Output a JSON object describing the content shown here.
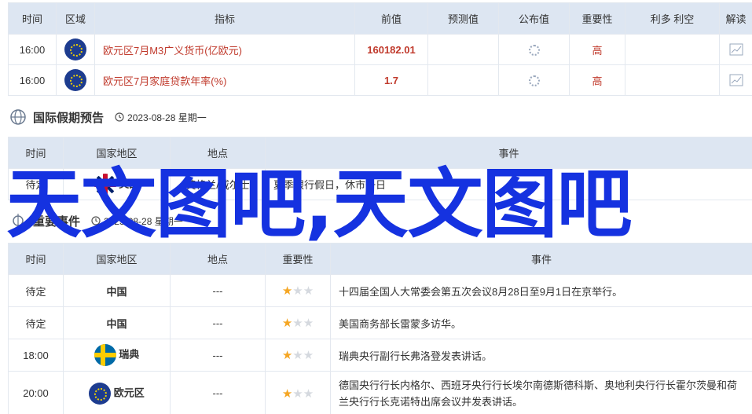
{
  "calendar_table": {
    "headers": [
      "时间",
      "区域",
      "指标",
      "前值",
      "预测值",
      "公布值",
      "重要性",
      "利多 利空",
      "解读"
    ],
    "rows": [
      {
        "time": "16:00",
        "flag": "eu-flag",
        "indicator": "欧元区7月M3广义货币(亿欧元)",
        "previous": "160182.01",
        "forecast": "",
        "actual": "loading-spinner-icon",
        "importance": "高"
      },
      {
        "time": "16:00",
        "flag": "eu-flag",
        "indicator": "欧元区7月家庭贷款年率(%)",
        "previous": "1.7",
        "forecast": "",
        "actual": "loading-spinner-icon",
        "importance": "高"
      }
    ]
  },
  "holiday_section": {
    "title": "国际假期预告",
    "date": "2023-08-28 星期一",
    "headers": [
      "时间",
      "国家地区",
      "地点",
      "事件"
    ],
    "rows": [
      {
        "time": "待定",
        "flag": "uk-flag",
        "country": "英国",
        "location": "英格兰/威尔士",
        "event": "夏季银行假日，休市一日"
      }
    ]
  },
  "events_section": {
    "title": "重要事件",
    "date": "2023-08-28 星期一",
    "headers": [
      "时间",
      "国家地区",
      "地点",
      "重要性",
      "事件"
    ],
    "rows": [
      {
        "time": "待定",
        "country": "中国",
        "location": "---",
        "stars": 1,
        "event": "十四届全国人大常委会第五次会议8月28日至9月1日在京举行。"
      },
      {
        "time": "待定",
        "country": "中国",
        "location": "---",
        "stars": 1,
        "event": "美国商务部长雷蒙多访华。"
      },
      {
        "time": "18:00",
        "flag": "sweden-flag",
        "country": "瑞典",
        "location": "---",
        "stars": 1,
        "event": "瑞典央行副行长弗洛登发表讲话。"
      },
      {
        "time": "20:00",
        "flag": "eu-flag",
        "country": "欧元区",
        "location": "---",
        "stars": 1,
        "event": "德国央行行长内格尔、西班牙央行行长埃尔南德斯德科斯、奥地利央行行长霍尔茨曼和荷兰央行行长克诺特出席会议并发表讲话。",
        "event_line1": "德国央行行长内格尔、西班牙央行行长埃尔南德斯德科斯、奥地利央行行长霍尔茨曼和荷兰央行行长克诺特出席会议并发表讲话。"
      }
    ]
  },
  "watermark": "天文图吧,天文图吧",
  "colors": {
    "header_bg": "#dde6f2",
    "border": "#e3e8ef",
    "importance_high": "#c0392b",
    "star_on": "#f5a623",
    "watermark": "#1532e0"
  }
}
